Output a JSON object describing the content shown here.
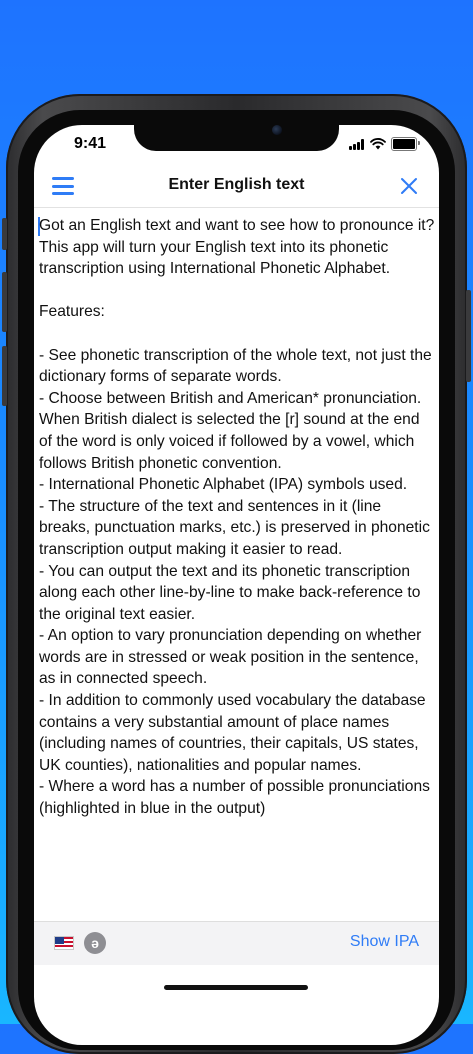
{
  "status_bar": {
    "time": "9:41"
  },
  "nav": {
    "title": "Enter English text",
    "menu_icon": "hamburger-menu-icon",
    "close_icon": "close-x-icon"
  },
  "content": {
    "text": "Got an English text and want to see how to pronounce it? This app will turn your English text into its phonetic transcription using International Phonetic Alphabet.\n\nFeatures:\n\n- See phonetic transcription of the whole text, not just the dictionary forms of separate words.\n- Choose between British and American* pronunciation. When British dialect is selected the [r] sound at the end of the word is only voiced if followed by a vowel, which follows British phonetic convention.\n- International Phonetic Alphabet (IPA) symbols used.\n- The structure of the text and sentences in it (line breaks, punctuation marks, etc.) is preserved in phonetic transcription output making it easier to read.\n- You can output the text and its phonetic transcription along each other line-by-line to make back-reference to the original text easier.\n- An option to vary pronunciation depending on whether words are in stressed or weak position in the sentence, as in connected speech.\n- In addition to commonly used vocabulary the database contains a very substantial amount of place names (including names of countries, their capitals, US states, UK counties), nationalities and popular names.\n- Where a word has a number of possible pronunciations (highlighted in blue in the output)"
  },
  "toolbar": {
    "flag_icon": "us-flag-icon",
    "schwa_icon": "schwa-icon",
    "schwa_glyph": "ə",
    "show_ipa_label": "Show IPA"
  },
  "colors": {
    "accent": "#2f7cf6",
    "background_top": "#1e73ff",
    "background_bottom": "#19b6ff"
  }
}
